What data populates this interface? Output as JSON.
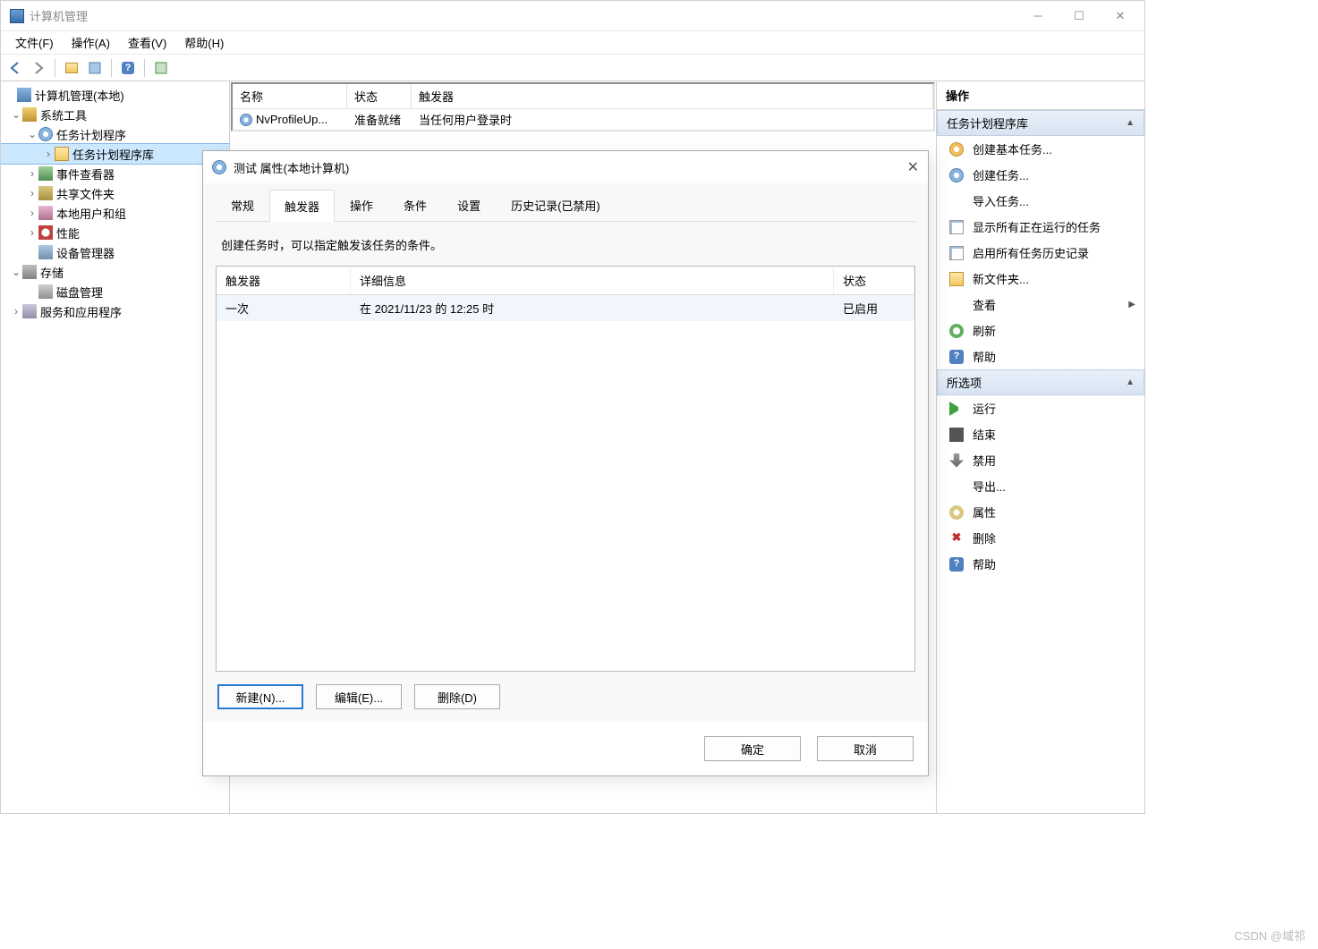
{
  "window": {
    "title": "计算机管理"
  },
  "menubar": {
    "file": "文件(F)",
    "action": "操作(A)",
    "view": "查看(V)",
    "help": "帮助(H)"
  },
  "tree": {
    "root": "计算机管理(本地)",
    "system_tools": "系统工具",
    "task_scheduler": "任务计划程序",
    "task_scheduler_lib": "任务计划程序库",
    "event_viewer": "事件查看器",
    "shared_folders": "共享文件夹",
    "local_users": "本地用户和组",
    "performance": "性能",
    "device_manager": "设备管理器",
    "storage": "存储",
    "disk_mgmt": "磁盘管理",
    "services_apps": "服务和应用程序"
  },
  "center": {
    "headers": {
      "name": "名称",
      "status": "状态",
      "trigger": "触发器"
    },
    "row0": {
      "name": "NvProfileUp...",
      "status": "准备就绪",
      "trigger": "当任何用户登录时"
    }
  },
  "actions": {
    "title": "操作",
    "section_lib": "任务计划程序库",
    "create_basic": "创建基本任务...",
    "create_task": "创建任务...",
    "import_task": "导入任务...",
    "show_running": "显示所有正在运行的任务",
    "enable_history": "启用所有任务历史记录",
    "new_folder": "新文件夹...",
    "view": "查看",
    "refresh": "刷新",
    "help": "帮助",
    "section_sel": "所选项",
    "run": "运行",
    "end": "结束",
    "disable": "禁用",
    "export": "导出...",
    "properties": "属性",
    "delete": "删除",
    "help2": "帮助"
  },
  "dialog": {
    "title": "测试 属性(本地计算机)",
    "tabs": {
      "general": "常规",
      "triggers": "触发器",
      "actions": "操作",
      "conditions": "条件",
      "settings": "设置",
      "history": "历史记录(已禁用)"
    },
    "desc": "创建任务时，可以指定触发该任务的条件。",
    "table": {
      "headers": {
        "trigger": "触发器",
        "detail": "详细信息",
        "status": "状态"
      },
      "row0": {
        "trigger": "一次",
        "detail": "在 2021/11/23 的 12:25 时",
        "status": "已启用"
      }
    },
    "buttons": {
      "new": "新建(N)...",
      "edit": "编辑(E)...",
      "delete": "删除(D)",
      "ok": "确定",
      "cancel": "取消"
    }
  },
  "watermark": "CSDN @域祁"
}
